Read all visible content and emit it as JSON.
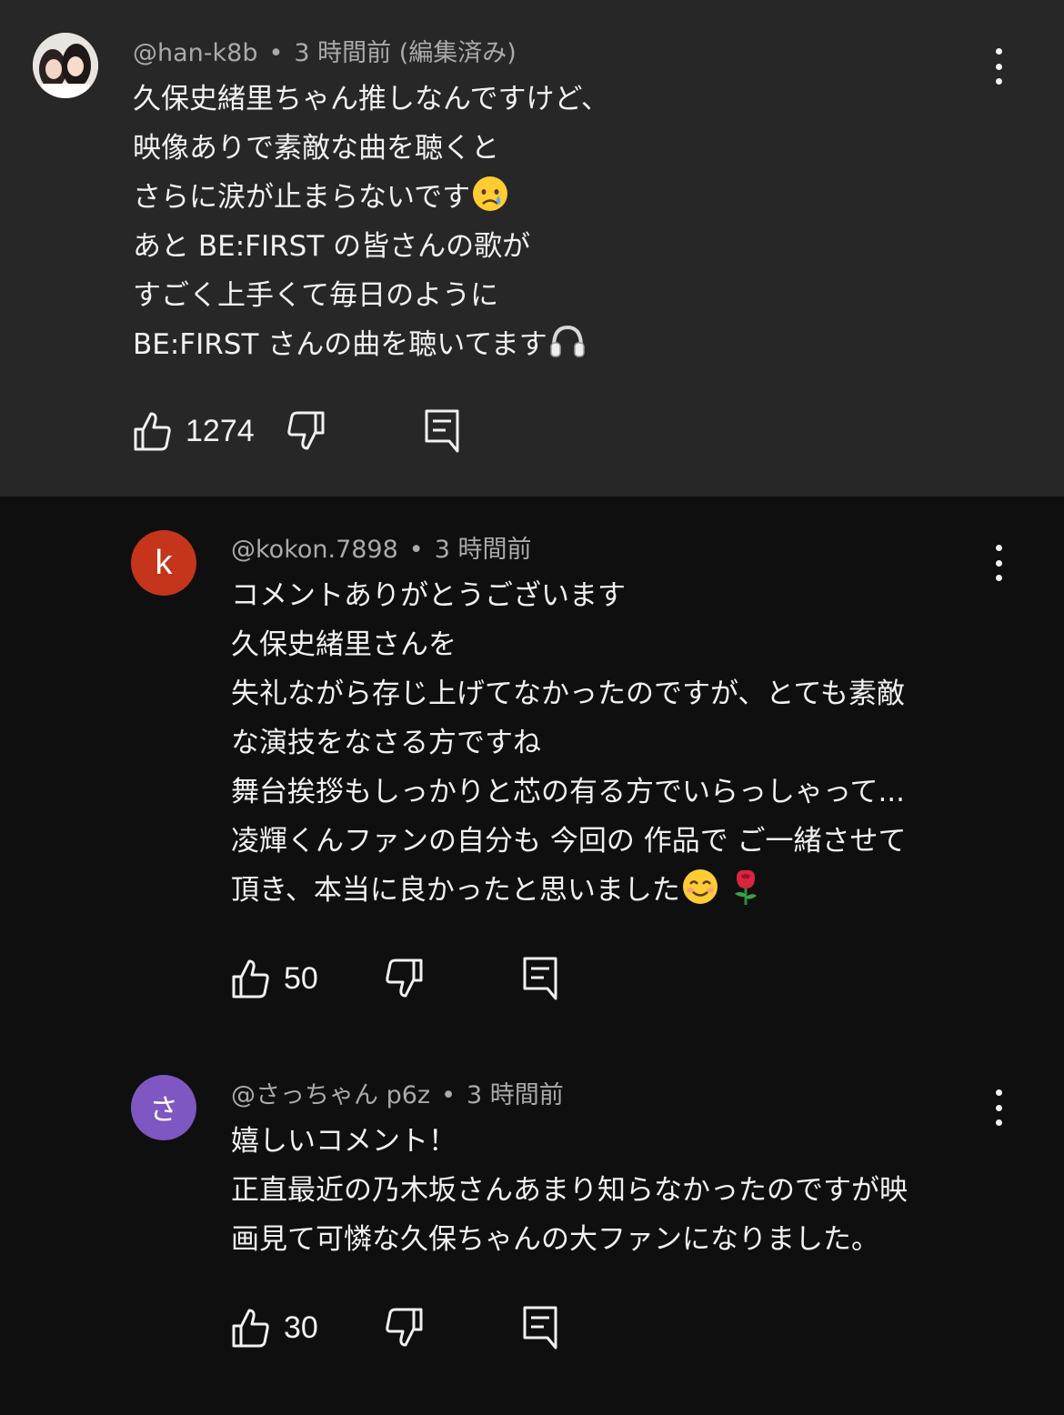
{
  "comments": [
    {
      "author": "@han-k8b",
      "time": "3 時間前 (編集済み)",
      "lines": [
        "久保史緒里ちゃん推しなんですけど、",
        "映像ありで素敵な曲を聴くと",
        "さらに涙が止まらないです",
        "あと BE:FIRST の皆さんの歌が",
        "すごく上手くて毎日のように",
        "BE:FIRST さんの曲を聴いてます"
      ],
      "emoji": [
        "crying-face",
        "headphones"
      ],
      "likes": "1274"
    },
    {
      "author": "@kokon.7898",
      "time": "3 時間前",
      "avatar_letter": "k",
      "avatar_color": "#c4351b",
      "lines": [
        "コメントありがとうございます",
        "久保史緒里さんを",
        "失礼ながら存じ上げてなかったのですが、とても素敵",
        "な演技をなさる方ですね",
        "舞台挨拶もしっかりと芯の有る方でいらっしゃって...",
        "凌輝くんファンの自分も 今回の 作品で ご一緒させて",
        "頂き、本当に良かったと思いました"
      ],
      "emoji": [
        "smiling-face",
        "rose"
      ],
      "likes": "50"
    },
    {
      "author": "@さっちゃん p6z",
      "time": "3 時間前",
      "avatar_letter": "さ",
      "avatar_color": "#7e57c2",
      "lines": [
        "嬉しいコメント！",
        "正直最近の乃木坂さんあまり知らなかったのですが映",
        "画見て可憐な久保ちゃんの大ファンになりました。"
      ],
      "likes": "30"
    }
  ],
  "icons": {
    "like": "thumbs-up-icon",
    "dislike": "thumbs-down-icon",
    "reply": "reply-comment-icon",
    "menu": "more-vertical-icon"
  },
  "colors": {
    "background": "#0f0f0f",
    "highlight": "#272727",
    "text": "#f1f1f1",
    "secondary": "#aaaaaa"
  }
}
